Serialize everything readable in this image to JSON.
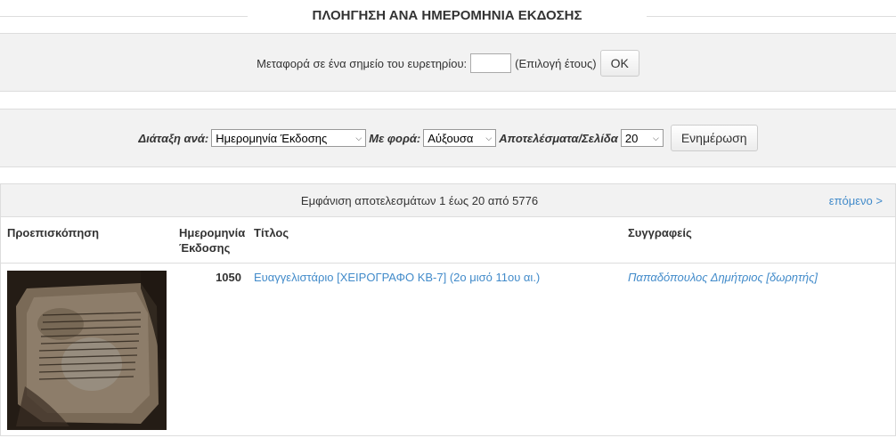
{
  "page_title": "ΠΛΟΗΓΗΣΗ ΑΝΑ ΗΜΕΡΟΜΗΝΙΑ ΕΚΔΟΣΗΣ",
  "jump": {
    "label": "Μεταφορά σε ένα σημείο του ευρετηρίου:",
    "input_value": "",
    "hint": "(Επιλογή έτους)",
    "ok_label": "OK"
  },
  "sort": {
    "sort_by_label": "Διάταξη ανά:",
    "sort_by_value": "Ημερομηνία Έκδοσης",
    "order_label": "Με φορά:",
    "order_value": "Αύξουσα",
    "rpp_label": "Αποτελέσματα/Σελίδα",
    "rpp_value": "20",
    "update_label": "Ενημέρωση"
  },
  "results": {
    "info": "Εμφάνιση αποτελεσμάτων 1 έως 20 από 5776",
    "next_label": "επόμενο >",
    "columns": {
      "preview": "Προεπισκόπηση",
      "date": "Ημερομηνία Έκδοσης",
      "title": "Τίτλος",
      "authors": "Συγγραφείς"
    },
    "rows": [
      {
        "thumbnail": "manuscript-thumbnail",
        "date": "1050",
        "title": "Ευαγγελιστάριο [ΧΕΙΡΟΓΡΑΦΟ ΚΒ-7] (2ο μισό 11ου αι.)",
        "author": "Παπαδόπουλος Δημήτριος [δωρητής]"
      }
    ]
  },
  "colors": {
    "link": "#428bca",
    "panel_bg": "#f2f2f2",
    "border": "#dddddd"
  }
}
